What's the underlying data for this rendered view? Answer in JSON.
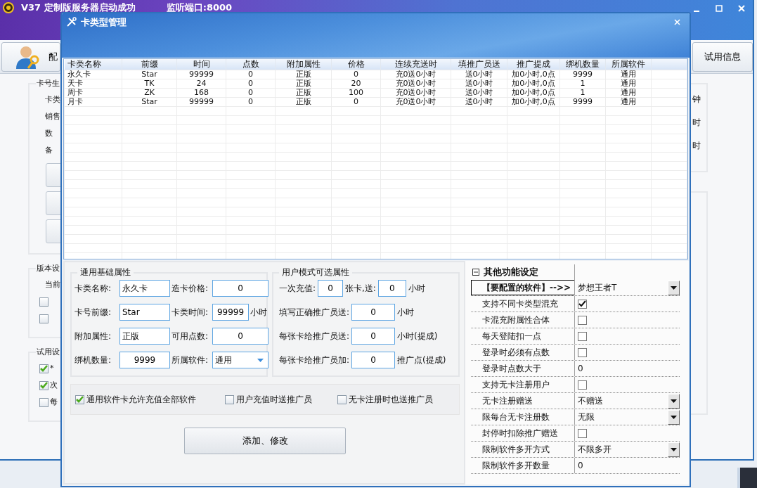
{
  "main_window": {
    "title": "V37  定制版服务器启动成功",
    "status": "监听端口:8000",
    "toolbar": {
      "left_button": "配",
      "right_button": "试用信息"
    },
    "left_groups": [
      {
        "title": "卡号生",
        "items": [
          {
            "kind": "label",
            "text": "卡类"
          },
          {
            "kind": "label",
            "text": "销售"
          },
          {
            "kind": "label",
            "text": "数"
          },
          {
            "kind": "label",
            "text": "备"
          },
          {
            "kind": "button"
          },
          {
            "kind": "button"
          },
          {
            "kind": "button"
          }
        ]
      },
      {
        "title": "版本设",
        "items": [
          {
            "kind": "label",
            "text": "当前"
          },
          {
            "kind": "checkbox",
            "checked": false
          },
          {
            "kind": "checkbox",
            "checked": false
          }
        ]
      },
      {
        "title": "试用设",
        "items": [
          {
            "kind": "checkbox",
            "checked": true,
            "text": "*"
          },
          {
            "kind": "checkbox",
            "checked": true,
            "text": "次"
          },
          {
            "kind": "checkbox",
            "checked": false,
            "text": "每"
          }
        ]
      }
    ],
    "right_groups": [
      {
        "items": [
          {
            "kind": "label",
            "text": "钟"
          },
          {
            "kind": "label",
            "text": "时"
          },
          {
            "kind": "label",
            "text": "时"
          }
        ]
      }
    ]
  },
  "dialog": {
    "title": "卡类型管理",
    "table": {
      "columns": [
        "卡类名称",
        "前缀",
        "时间",
        "点数",
        "附加属性",
        "价格",
        "连续充送时",
        "填推广员送",
        "推广提成",
        "绑机数量",
        "所属软件"
      ],
      "rows": [
        [
          "永久卡",
          "Star",
          "99999",
          "0",
          "正版",
          "0",
          "充0送0小时",
          "送0小时",
          "加0小时,0点",
          "9999",
          "通用"
        ],
        [
          "天卡",
          "TK",
          "24",
          "0",
          "正版",
          "20",
          "充0送0小时",
          "送0小时",
          "加0小时,0点",
          "1",
          "通用"
        ],
        [
          "周卡",
          "ZK",
          "168",
          "0",
          "正版",
          "100",
          "充0送0小时",
          "送0小时",
          "加0小时,0点",
          "1",
          "通用"
        ],
        [
          "月卡",
          "Star",
          "99999",
          "0",
          "正版",
          "0",
          "充0送0小时",
          "送0小时",
          "加0小时,0点",
          "9999",
          "通用"
        ]
      ]
    },
    "basic_group": {
      "title": "通用基础属性",
      "fields": [
        {
          "label": "卡类名称:",
          "value": "永久卡",
          "kind": "text"
        },
        {
          "label": "造卡价格:",
          "value": "0",
          "kind": "number"
        },
        {
          "label": "卡号前缀:",
          "value": "Star",
          "kind": "text"
        },
        {
          "label": "卡类时间:",
          "value": "99999",
          "kind": "number",
          "suffix": "小时"
        },
        {
          "label": "附加属性:",
          "value": "正版",
          "kind": "text"
        },
        {
          "label": "可用点数:",
          "value": "0",
          "kind": "number"
        },
        {
          "label": "绑机数量:",
          "value": "9999",
          "kind": "number"
        },
        {
          "label": "所属软件:",
          "value": "通用",
          "kind": "dropdown"
        }
      ]
    },
    "user_group": {
      "title": "用户模式可选属性",
      "rows": [
        {
          "parts": [
            {
              "kind": "text",
              "text": "一次充值:"
            },
            {
              "kind": "input",
              "value": "0"
            },
            {
              "kind": "text",
              "text": "张卡,送:"
            },
            {
              "kind": "input",
              "value": "0"
            },
            {
              "kind": "text",
              "text": "小时"
            }
          ]
        },
        {
          "parts": [
            {
              "kind": "text",
              "text": "填写正确推广员送:"
            },
            {
              "kind": "input",
              "value": "0"
            },
            {
              "kind": "text",
              "text": "小时"
            }
          ]
        },
        {
          "parts": [
            {
              "kind": "text",
              "text": "每张卡给推广员送:"
            },
            {
              "kind": "input",
              "value": "0"
            },
            {
              "kind": "text",
              "text": "小时(提成)"
            }
          ]
        },
        {
          "parts": [
            {
              "kind": "text",
              "text": "每张卡给推广员加:"
            },
            {
              "kind": "input",
              "value": "0"
            },
            {
              "kind": "text",
              "text": "推广点(提成)"
            }
          ]
        }
      ]
    },
    "options": [
      {
        "label": "通用软件卡允许充值全部软件",
        "checked": true
      },
      {
        "label": "用户充值时送推广员",
        "checked": false
      },
      {
        "label": "无卡注册时也送推广员",
        "checked": false
      }
    ],
    "submit_button": "添加、修改",
    "property_grid": {
      "title": "其他功能设定",
      "expanded": true,
      "rows": [
        {
          "label": "【要配置的软件】-->>",
          "kind": "dropdown",
          "value": "梦想王者T",
          "selected": true
        },
        {
          "label": "支持不同卡类型混充",
          "kind": "checkbox",
          "checked": true,
          "selected": false
        },
        {
          "label": "卡混充附属性合体",
          "kind": "checkbox",
          "checked": false,
          "selected": false
        },
        {
          "label": "每天登陆扣一点",
          "kind": "checkbox",
          "checked": false,
          "selected": false
        },
        {
          "label": "登录时必须有点数",
          "kind": "checkbox",
          "checked": false,
          "selected": false
        },
        {
          "label": "登录时点数大于",
          "kind": "text",
          "value": "0",
          "selected": false
        },
        {
          "label": "支持无卡注册用户",
          "kind": "checkbox",
          "checked": false,
          "selected": false
        },
        {
          "label": "无卡注册赠送",
          "kind": "dropdown",
          "value": "不赠送",
          "selected": false
        },
        {
          "label": "限每台无卡注册数",
          "kind": "dropdown",
          "value": "无限",
          "selected": false
        },
        {
          "label": "封停时扣除推广赠送",
          "kind": "checkbox",
          "checked": false,
          "selected": false
        },
        {
          "label": "限制软件多开方式",
          "kind": "dropdown",
          "value": "不限多开",
          "selected": false
        },
        {
          "label": "限制软件多开数量",
          "kind": "text",
          "value": "0",
          "selected": false
        }
      ]
    }
  }
}
